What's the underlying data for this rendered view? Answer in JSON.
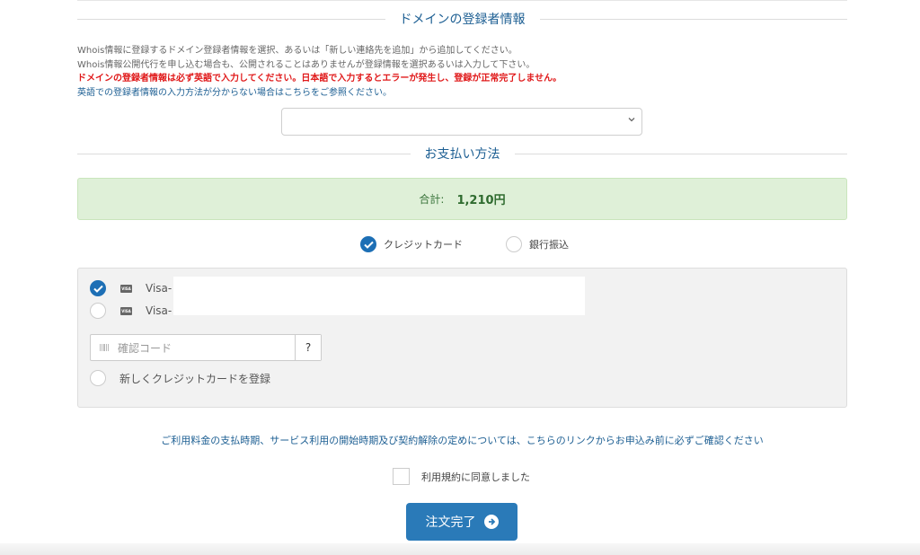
{
  "registrant": {
    "title": "ドメインの登録者情報",
    "note1": "Whois情報に登録するドメイン登録者情報を選択、あるいは「新しい連絡先を追加」から追加してください。",
    "note2": "Whois情報公開代行を申し込む場合も、公開されることはありませんが登録情報を選択あるいは入力して下さい。",
    "warning": "ドメインの登録者情報は必ず英語で入力してください。日本語で入力するとエラーが発生し、登録が正常完了しません。",
    "help_link": "英語での登録者情報の入力方法が分からない場合はこちらをご参照ください。",
    "select_value": ""
  },
  "payment": {
    "title": "お支払い方法",
    "total_label": "合計:",
    "total_amount": "1,210円",
    "methods": [
      {
        "label": "クレジットカード",
        "selected": true
      },
      {
        "label": "銀行振込",
        "selected": false
      }
    ],
    "cards": [
      {
        "brand": "VISA",
        "label": "Visa-",
        "selected": true
      },
      {
        "brand": "VISA",
        "label": "Visa-",
        "selected": false
      }
    ],
    "cvc_placeholder": "確認コード",
    "cvc_help": "?",
    "new_card_label": "新しくクレジットカードを登録"
  },
  "terms": {
    "notice": "ご利用料金の支払時期、サービス利用の開始時期及び契約解除の定めについては、こちらのリンクからお申込み前に必ずご確認ください",
    "agree_label": "利用規約に同意しました",
    "agreed": false
  },
  "submit_label": "注文完了",
  "colors": {
    "accent": "#2a7ab8",
    "heading": "#1d5f93",
    "warning": "#e0191a",
    "success_bg": "#dff0d8"
  }
}
